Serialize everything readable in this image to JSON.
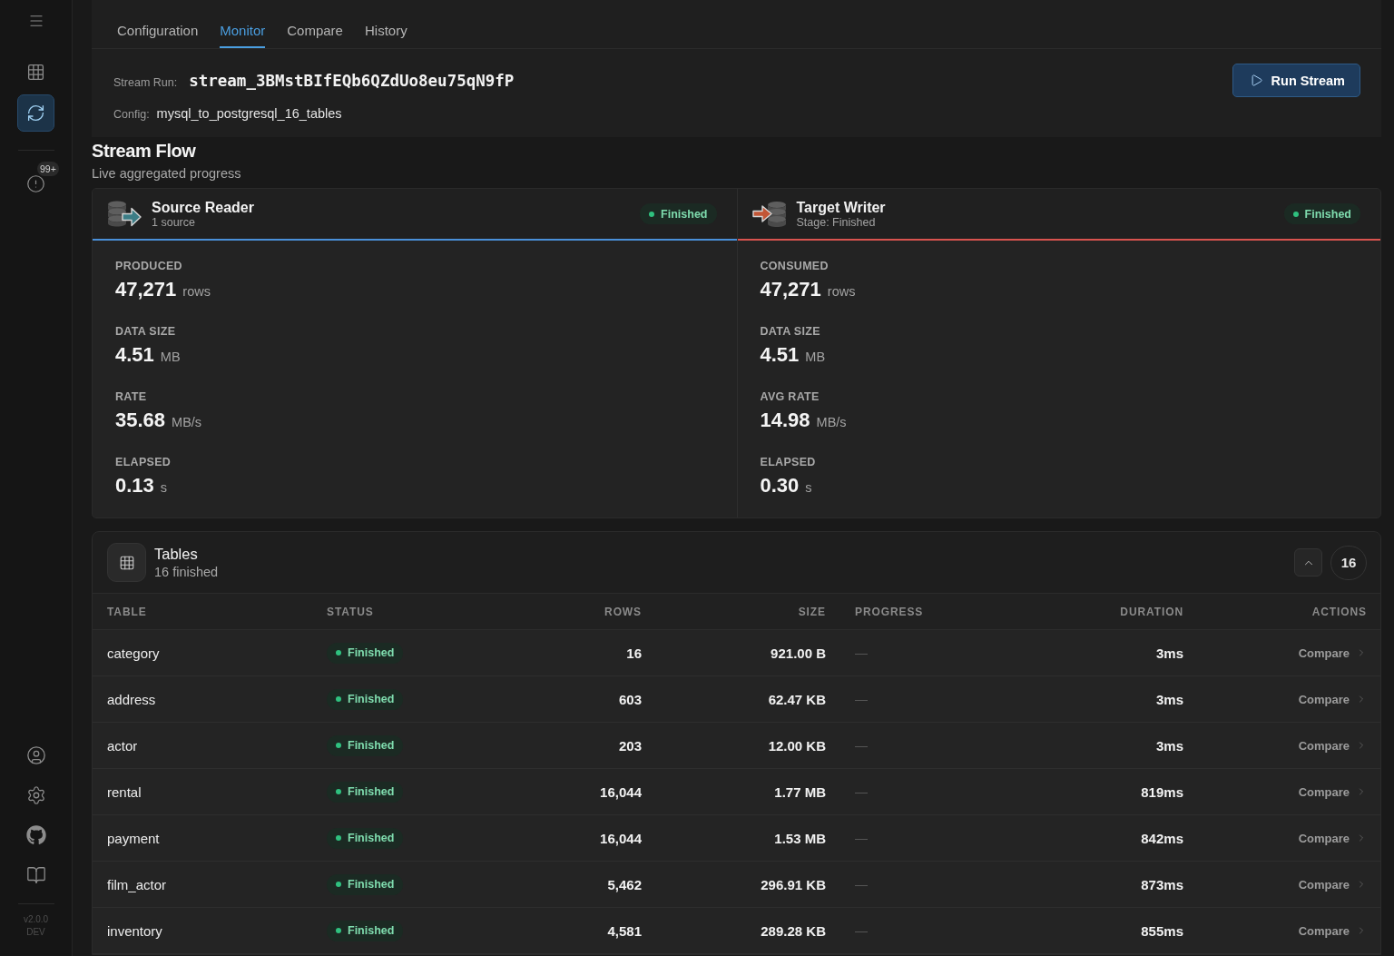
{
  "sidebar": {
    "nav": [
      {
        "kind": "table",
        "selected": false
      },
      {
        "kind": "sync",
        "selected": true
      }
    ],
    "alerts_badge": "99+",
    "footer_links": [
      {
        "kind": "user"
      },
      {
        "kind": "settings"
      },
      {
        "kind": "github"
      },
      {
        "kind": "docs"
      }
    ],
    "version": "v2.0.0",
    "build": "DEV"
  },
  "tabs": [
    {
      "label": "Configuration",
      "selected": false
    },
    {
      "label": "Monitor",
      "selected": true
    },
    {
      "label": "Compare",
      "selected": false
    },
    {
      "label": "History",
      "selected": false
    }
  ],
  "run": {
    "run_label": "Stream Run:",
    "run_id": "stream_3BMstBIfEQb6QZdUo8eu75qN9fP",
    "config_label": "Config:",
    "config": "mysql_to_postgresql_16_tables",
    "button": "Run Stream"
  },
  "flow": {
    "title": "Stream Flow",
    "subtitle": "Live aggregated progress",
    "stages": [
      {
        "kind": "source",
        "name": "Source Reader",
        "detail": "1 source",
        "status": "Finished",
        "color": "#4a90d9",
        "stats": [
          {
            "label": "PRODUCED",
            "value": "47,271",
            "unit": "rows"
          },
          {
            "label": "DATA SIZE",
            "value": "4.51",
            "unit": "MB"
          },
          {
            "label": "RATE",
            "value": "35.68",
            "unit": "MB/s"
          },
          {
            "label": "ELAPSED",
            "value": "0.13",
            "unit": "s"
          }
        ]
      },
      {
        "kind": "target",
        "name": "Target Writer",
        "detail": "Stage: Finished",
        "status": "Finished",
        "color": "#d9534f",
        "stats": [
          {
            "label": "CONSUMED",
            "value": "47,271",
            "unit": "rows"
          },
          {
            "label": "DATA SIZE",
            "value": "4.51",
            "unit": "MB"
          },
          {
            "label": "AVG RATE",
            "value": "14.98",
            "unit": "MB/s"
          },
          {
            "label": "ELAPSED",
            "value": "0.30",
            "unit": "s"
          }
        ]
      }
    ]
  },
  "tables": {
    "title": "Tables",
    "subtitle": "16 finished",
    "expanded": true,
    "count": "16",
    "columns": [
      "TABLE",
      "STATUS",
      "ROWS",
      "SIZE",
      "PROGRESS",
      "DURATION",
      "ACTIONS"
    ],
    "rows": [
      {
        "table": "category",
        "status": "Finished",
        "rows": "16",
        "size": "921.00 B",
        "progress": "—",
        "duration": "3ms",
        "action": "Compare"
      },
      {
        "table": "address",
        "status": "Finished",
        "rows": "603",
        "size": "62.47 KB",
        "progress": "—",
        "duration": "3ms",
        "action": "Compare"
      },
      {
        "table": "actor",
        "status": "Finished",
        "rows": "203",
        "size": "12.00 KB",
        "progress": "—",
        "duration": "3ms",
        "action": "Compare"
      },
      {
        "table": "rental",
        "status": "Finished",
        "rows": "16,044",
        "size": "1.77 MB",
        "progress": "—",
        "duration": "819ms",
        "action": "Compare"
      },
      {
        "table": "payment",
        "status": "Finished",
        "rows": "16,044",
        "size": "1.53 MB",
        "progress": "—",
        "duration": "842ms",
        "action": "Compare"
      },
      {
        "table": "film_actor",
        "status": "Finished",
        "rows": "5,462",
        "size": "296.91 KB",
        "progress": "—",
        "duration": "873ms",
        "action": "Compare"
      },
      {
        "table": "inventory",
        "status": "Finished",
        "rows": "4,581",
        "size": "289.28 KB",
        "progress": "—",
        "duration": "855ms",
        "action": "Compare"
      }
    ]
  }
}
